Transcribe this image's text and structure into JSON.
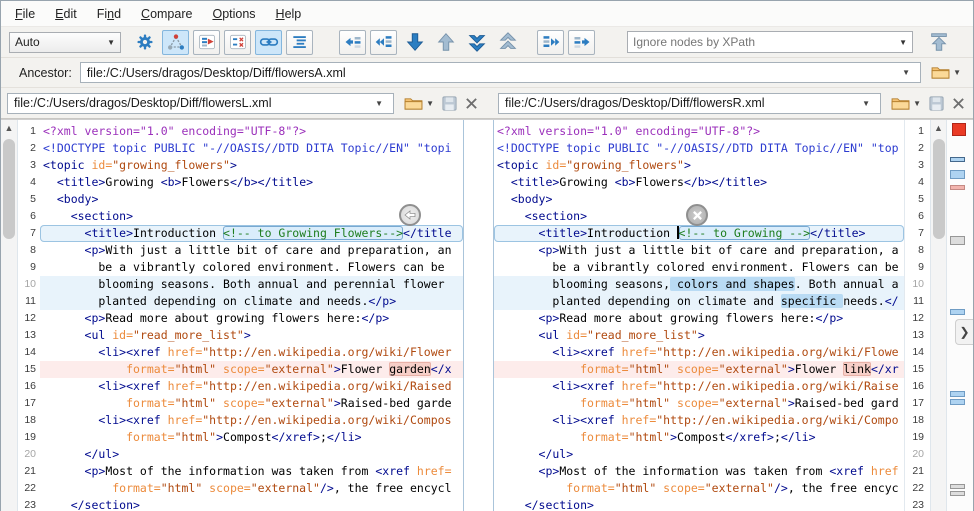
{
  "menu": {
    "items": [
      {
        "label": "File",
        "mnemonic": 0
      },
      {
        "label": "Edit",
        "mnemonic": 0
      },
      {
        "label": "Find",
        "mnemonic": 2
      },
      {
        "label": "Compare",
        "mnemonic": 0
      },
      {
        "label": "Options",
        "mnemonic": 0
      },
      {
        "label": "Help",
        "mnemonic": 0
      }
    ]
  },
  "toolbar": {
    "algorithm_value": "Auto",
    "xpath_placeholder": "Ignore nodes by XPath",
    "icons": [
      "gear-icon",
      "three-way-diff-icon",
      "flagged-diff-icon",
      "x-marks-grid-icon",
      "chain-link-icon",
      "format-indent-icon",
      "copy-change-left-icon",
      "copy-all-left-icon",
      "next-difference-icon",
      "previous-difference-icon",
      "last-difference-icon",
      "first-difference-icon",
      "copy-all-right-icon",
      "copy-change-right-icon",
      "go-first-change-icon"
    ]
  },
  "ancestor": {
    "label": "Ancestor:",
    "path": "file:/C:/Users/dragos/Desktop/Diff/flowersA.xml"
  },
  "files": {
    "left": {
      "path": "file:/C:/Users/dragos/Desktop/Diff/flowersL.xml"
    },
    "right": {
      "path": "file:/C:/Users/dragos/Desktop/Diff/flowersR.xml"
    }
  },
  "left_pane": {
    "lines": [
      {
        "n": 1,
        "segs": [
          [
            "pi",
            "<?xml version=\"1.0\" encoding=\"UTF-8\"?>"
          ]
        ]
      },
      {
        "n": 2,
        "segs": [
          [
            "dt",
            "<!DOCTYPE topic PUBLIC \"-//OASIS//DTD DITA Topic//EN\" \"topi"
          ]
        ]
      },
      {
        "n": 3,
        "segs": [
          [
            "tg",
            "<topic "
          ],
          [
            "an",
            "id="
          ],
          [
            "av",
            "\"growing_flowers\""
          ],
          [
            "tg",
            ">"
          ]
        ]
      },
      {
        "n": 4,
        "segs": [
          [
            "tg",
            "  <title>"
          ],
          [
            "tx",
            "Growing "
          ],
          [
            "tg",
            "<b>"
          ],
          [
            "tx",
            "Flowers"
          ],
          [
            "tg",
            "</b></title>"
          ]
        ]
      },
      {
        "n": 5,
        "segs": [
          [
            "tg",
            "  <body>"
          ]
        ]
      },
      {
        "n": 6,
        "segs": [
          [
            "tg",
            "    <section>"
          ]
        ]
      },
      {
        "n": 7,
        "bg": "blue",
        "framed": true,
        "segs": [
          [
            "tg",
            "      <title>"
          ],
          [
            "tx",
            "Introduction "
          ],
          [
            "cm",
            "<!-- to Growing Flowers-->",
            "combox"
          ],
          [
            "tg",
            "</title"
          ]
        ]
      },
      {
        "n": 8,
        "segs": [
          [
            "tg",
            "      <p>"
          ],
          [
            "tx",
            "With just a little bit of care and preparation, an"
          ]
        ]
      },
      {
        "n": 9,
        "segs": [
          [
            "tx",
            "        be a vibrantly colored environment. Flowers can be"
          ]
        ]
      },
      {
        "n": 10,
        "bg": "blue",
        "segs": [
          [
            "tx",
            "        blooming seasons. Both annual and perennial flower"
          ]
        ]
      },
      {
        "n": 11,
        "bg": "blue",
        "segs": [
          [
            "tx",
            "        planted depending on climate and needs."
          ],
          [
            "tg",
            "</p>"
          ]
        ]
      },
      {
        "n": 12,
        "segs": [
          [
            "tg",
            "      <p>"
          ],
          [
            "tx",
            "Read more about growing flowers here:"
          ],
          [
            "tg",
            "</p>"
          ]
        ]
      },
      {
        "n": 13,
        "segs": [
          [
            "tg",
            "      <ul "
          ],
          [
            "an",
            "id="
          ],
          [
            "av",
            "\"read_more_list\""
          ],
          [
            "tg",
            ">"
          ]
        ]
      },
      {
        "n": 14,
        "segs": [
          [
            "tg",
            "        <li><xref "
          ],
          [
            "an",
            "href="
          ],
          [
            "av",
            "\"http://en.wikipedia.org/wiki/Flower"
          ]
        ]
      },
      {
        "n": 15,
        "bg": "pink",
        "segs": [
          [
            "an",
            "            format="
          ],
          [
            "av",
            "\"html\""
          ],
          [
            "an",
            " scope="
          ],
          [
            "av",
            "\"external\""
          ],
          [
            "tg",
            ">"
          ],
          [
            "tx",
            "Flower "
          ],
          [
            "tx",
            "garden",
            "hlp"
          ],
          [
            "tg",
            "</x"
          ]
        ]
      },
      {
        "n": 16,
        "segs": [
          [
            "tg",
            "        <li><xref "
          ],
          [
            "an",
            "href="
          ],
          [
            "av",
            "\"http://en.wikipedia.org/wiki/Raised"
          ]
        ]
      },
      {
        "n": 17,
        "segs": [
          [
            "an",
            "            format="
          ],
          [
            "av",
            "\"html\""
          ],
          [
            "an",
            " scope="
          ],
          [
            "av",
            "\"external\""
          ],
          [
            "tg",
            ">"
          ],
          [
            "tx",
            "Raised-bed garde"
          ]
        ]
      },
      {
        "n": 18,
        "segs": [
          [
            "tg",
            "        <li><xref "
          ],
          [
            "an",
            "href="
          ],
          [
            "av",
            "\"http://en.wikipedia.org/wiki/Compos"
          ]
        ]
      },
      {
        "n": 19,
        "segs": [
          [
            "an",
            "            format="
          ],
          [
            "av",
            "\"html\""
          ],
          [
            "tg",
            ">"
          ],
          [
            "tx",
            "Compost"
          ],
          [
            "tg",
            "</xref>"
          ],
          [
            "tx",
            ";"
          ],
          [
            "tg",
            "</li>"
          ]
        ]
      },
      {
        "n": 20,
        "segs": [
          [
            "tg",
            "      </ul>"
          ]
        ]
      },
      {
        "n": 21,
        "segs": [
          [
            "tg",
            "      <p>"
          ],
          [
            "tx",
            "Most of the information was taken from "
          ],
          [
            "tg",
            "<xref "
          ],
          [
            "an",
            "href="
          ]
        ]
      },
      {
        "n": 22,
        "segs": [
          [
            "an",
            "          format="
          ],
          [
            "av",
            "\"html\""
          ],
          [
            "an",
            " scope="
          ],
          [
            "av",
            "\"external\""
          ],
          [
            "tg",
            "/>"
          ],
          [
            "tx",
            ", the free encycl"
          ]
        ]
      },
      {
        "n": 23,
        "segs": [
          [
            "tg",
            "    </section>"
          ]
        ]
      }
    ]
  },
  "right_pane": {
    "lines": [
      {
        "n": 1,
        "segs": [
          [
            "pi",
            "<?xml version=\"1.0\" encoding=\"UTF-8\"?>"
          ]
        ]
      },
      {
        "n": 2,
        "segs": [
          [
            "dt",
            "<!DOCTYPE topic PUBLIC \"-//OASIS//DTD DITA Topic//EN\" \"top"
          ]
        ]
      },
      {
        "n": 3,
        "segs": [
          [
            "tg",
            "<topic "
          ],
          [
            "an",
            "id="
          ],
          [
            "av",
            "\"growing_flowers\""
          ],
          [
            "tg",
            ">"
          ]
        ]
      },
      {
        "n": 4,
        "segs": [
          [
            "tg",
            "  <title>"
          ],
          [
            "tx",
            "Growing "
          ],
          [
            "tg",
            "<b>"
          ],
          [
            "tx",
            "Flowers"
          ],
          [
            "tg",
            "</b></title>"
          ]
        ]
      },
      {
        "n": 5,
        "segs": [
          [
            "tg",
            "  <body>"
          ]
        ]
      },
      {
        "n": 6,
        "segs": [
          [
            "tg",
            "    <section>"
          ]
        ]
      },
      {
        "n": 7,
        "bg": "blue",
        "framed": true,
        "segs": [
          [
            "tg",
            "      <title>"
          ],
          [
            "tx",
            "Introduction "
          ],
          [
            "cur",
            ""
          ],
          [
            "cm",
            "<!-- to Growing -->",
            "combox"
          ],
          [
            "tg",
            "</title>"
          ]
        ]
      },
      {
        "n": 8,
        "segs": [
          [
            "tg",
            "      <p>"
          ],
          [
            "tx",
            "With just a little bit of care and preparation, a"
          ]
        ]
      },
      {
        "n": 9,
        "segs": [
          [
            "tx",
            "        be a vibrantly colored environment. Flowers can be"
          ]
        ]
      },
      {
        "n": 10,
        "bg": "blue",
        "segs": [
          [
            "tx",
            "        blooming seasons,"
          ],
          [
            "tx",
            " colors and shapes",
            "hlb"
          ],
          [
            "tx",
            ". Both annual a"
          ]
        ]
      },
      {
        "n": 11,
        "bg": "blue",
        "segs": [
          [
            "tx",
            "        planted depending on climate and "
          ],
          [
            "tx",
            "specific ",
            "hlb"
          ],
          [
            "tx",
            "needs."
          ],
          [
            "tg",
            "</"
          ]
        ]
      },
      {
        "n": 12,
        "segs": [
          [
            "tg",
            "      <p>"
          ],
          [
            "tx",
            "Read more about growing flowers here:"
          ],
          [
            "tg",
            "</p>"
          ]
        ]
      },
      {
        "n": 13,
        "segs": [
          [
            "tg",
            "      <ul "
          ],
          [
            "an",
            "id="
          ],
          [
            "av",
            "\"read_more_list\""
          ],
          [
            "tg",
            ">"
          ]
        ]
      },
      {
        "n": 14,
        "segs": [
          [
            "tg",
            "        <li><xref "
          ],
          [
            "an",
            "href="
          ],
          [
            "av",
            "\"http://en.wikipedia.org/wiki/Flowe"
          ]
        ]
      },
      {
        "n": 15,
        "bg": "pink",
        "segs": [
          [
            "an",
            "            format="
          ],
          [
            "av",
            "\"html\""
          ],
          [
            "an",
            " scope="
          ],
          [
            "av",
            "\"external\""
          ],
          [
            "tg",
            ">"
          ],
          [
            "tx",
            "Flower "
          ],
          [
            "tx",
            "link",
            "hlp"
          ],
          [
            "tg",
            "</xr"
          ]
        ]
      },
      {
        "n": 16,
        "segs": [
          [
            "tg",
            "        <li><xref "
          ],
          [
            "an",
            "href="
          ],
          [
            "av",
            "\"http://en.wikipedia.org/wiki/Raise"
          ]
        ]
      },
      {
        "n": 17,
        "segs": [
          [
            "an",
            "            format="
          ],
          [
            "av",
            "\"html\""
          ],
          [
            "an",
            " scope="
          ],
          [
            "av",
            "\"external\""
          ],
          [
            "tg",
            ">"
          ],
          [
            "tx",
            "Raised-bed gard"
          ]
        ]
      },
      {
        "n": 18,
        "segs": [
          [
            "tg",
            "        <li><xref "
          ],
          [
            "an",
            "href="
          ],
          [
            "av",
            "\"http://en.wikipedia.org/wiki/Compo"
          ]
        ]
      },
      {
        "n": 19,
        "segs": [
          [
            "an",
            "            format="
          ],
          [
            "av",
            "\"html\""
          ],
          [
            "tg",
            ">"
          ],
          [
            "tx",
            "Compost"
          ],
          [
            "tg",
            "</xref>"
          ],
          [
            "tx",
            ";"
          ],
          [
            "tg",
            "</li>"
          ]
        ]
      },
      {
        "n": 20,
        "segs": [
          [
            "tg",
            "      </ul>"
          ]
        ]
      },
      {
        "n": 21,
        "segs": [
          [
            "tg",
            "      <p>"
          ],
          [
            "tx",
            "Most of the information was taken from "
          ],
          [
            "tg",
            "<xref "
          ],
          [
            "an",
            "href"
          ]
        ]
      },
      {
        "n": 22,
        "segs": [
          [
            "an",
            "          format="
          ],
          [
            "av",
            "\"html\""
          ],
          [
            "an",
            " scope="
          ],
          [
            "av",
            "\"external\""
          ],
          [
            "tg",
            "/>"
          ],
          [
            "tx",
            ", the free encyc"
          ]
        ]
      },
      {
        "n": 23,
        "segs": [
          [
            "tg",
            "    </section>"
          ]
        ]
      }
    ]
  },
  "ruler_markers": [
    {
      "t": 3,
      "h": 13,
      "c": "red"
    },
    {
      "t": 37,
      "h": 5,
      "c": "blueD"
    },
    {
      "t": 50,
      "h": 9,
      "c": "blue"
    },
    {
      "t": 65,
      "h": 5,
      "c": "pink"
    },
    {
      "t": 116,
      "h": 9,
      "c": "gray"
    },
    {
      "t": 189,
      "h": 6,
      "c": "blue"
    },
    {
      "t": 271,
      "h": 6,
      "c": "blue"
    },
    {
      "t": 279,
      "h": 6,
      "c": "blue"
    },
    {
      "t": 364,
      "h": 5,
      "c": "gray"
    },
    {
      "t": 371,
      "h": 5,
      "c": "gray"
    }
  ],
  "colors": {
    "diff_line_blue": "#e8f3fb",
    "diff_word_blue": "#b9dbf4",
    "diff_line_pink": "#fdeceb",
    "diff_word_pink": "#f7cfc8",
    "tag": "#000a8e",
    "attr_name": "#ec8b3c",
    "attr_value": "#b04a10",
    "comment": "#1d7d1d",
    "doctype": "#2c3bd0",
    "prolog": "#9b30bb",
    "toolbar_blue": "#2d7dc1",
    "selected_btn_bg": "#cde6f9"
  }
}
